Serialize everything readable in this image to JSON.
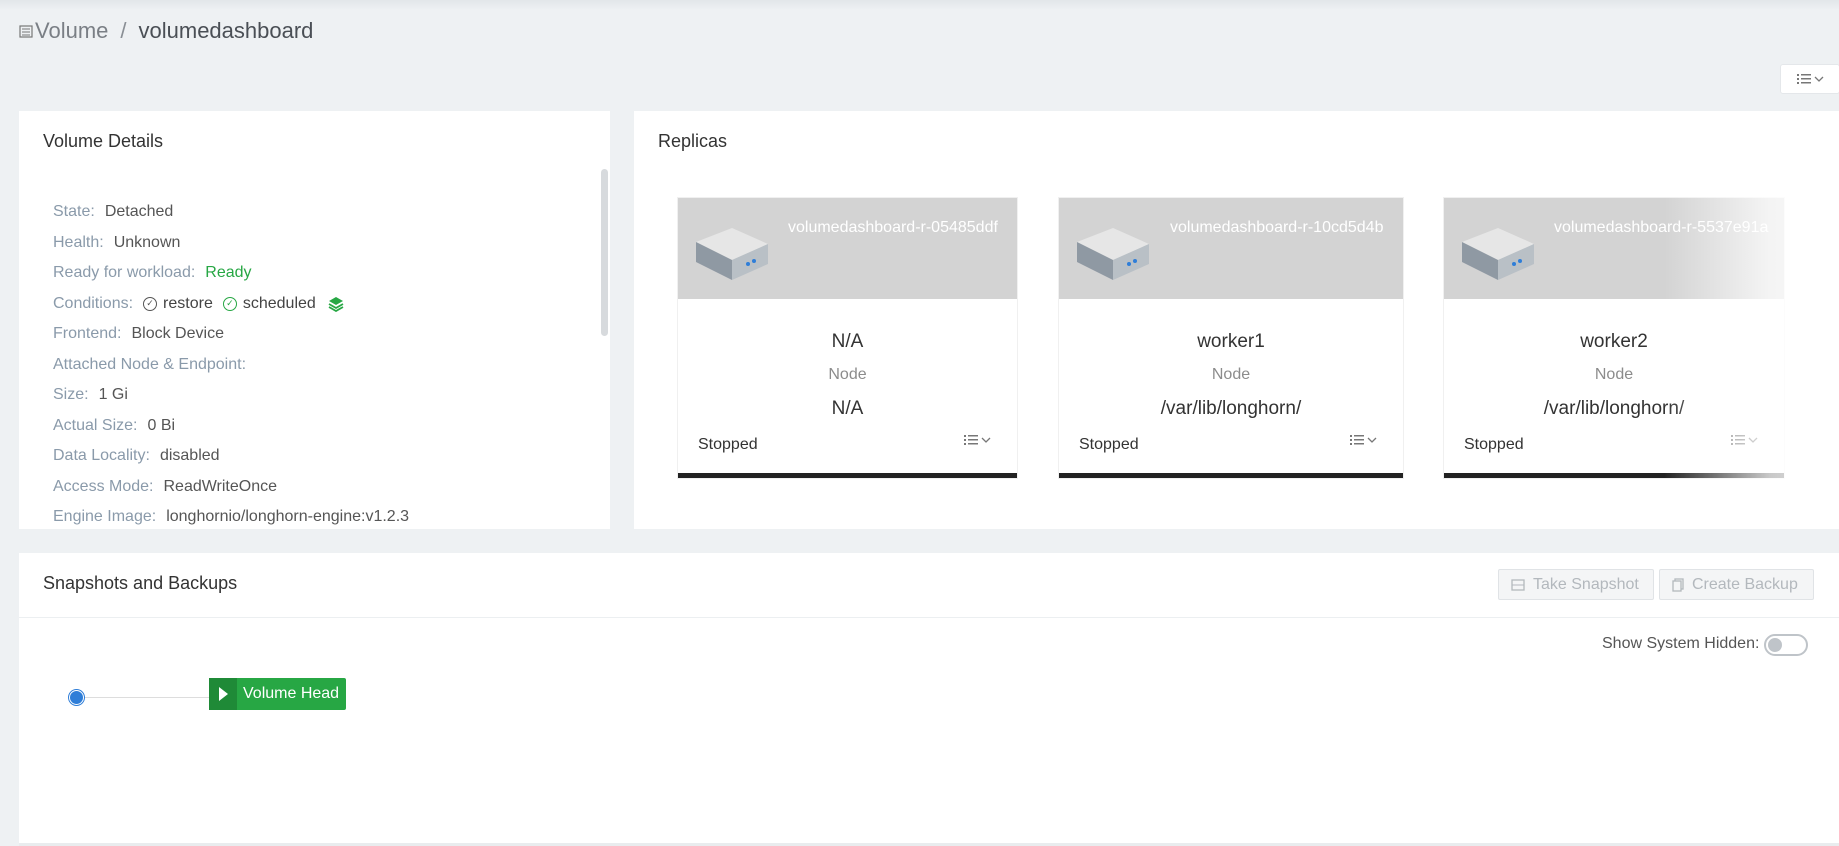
{
  "breadcrumb": {
    "root": "Volume",
    "separator": "/",
    "current": "volumedashboard"
  },
  "details": {
    "title": "Volume Details",
    "state_k": "State:",
    "state_v": "Detached",
    "health_k": "Health:",
    "health_v": "Unknown",
    "ready_k": "Ready for workload:",
    "ready_v": "Ready",
    "conditions_k": "Conditions:",
    "cond1": "restore",
    "cond2": "scheduled",
    "frontend_k": "Frontend:",
    "frontend_v": "Block Device",
    "attached_k": "Attached Node & Endpoint:",
    "size_k": "Size:",
    "size_v": "1 Gi",
    "actual_k": "Actual Size:",
    "actual_v": "0 Bi",
    "locality_k": "Data Locality:",
    "locality_v": "disabled",
    "access_k": "Access Mode:",
    "access_v": "ReadWriteOnce",
    "engine_k": "Engine Image:",
    "engine_v": "longhornio/longhorn-engine:v1.2.3"
  },
  "replicas": {
    "title": "Replicas",
    "node_label": "Node",
    "items": [
      {
        "name": "volumedashboard-r-05485ddf",
        "node": "N/A",
        "path": "N/A",
        "status": "Stopped"
      },
      {
        "name": "volumedashboard-r-10cd5d4b",
        "node": "worker1",
        "path": "/var/lib/longhorn/",
        "status": "Stopped"
      },
      {
        "name": "volumedashboard-r-5537e91a",
        "node": "worker2",
        "path": "/var/lib/longhorn/",
        "status": "Stopped"
      }
    ]
  },
  "snapshots": {
    "title": "Snapshots and Backups",
    "take_snapshot": "Take Snapshot",
    "create_backup": "Create Backup",
    "show_hidden": "Show System Hidden:",
    "volume_head": "Volume Head"
  },
  "colors": {
    "ready": "#27a744",
    "accent_blue": "#2f7ed8",
    "status_bar": "#222222"
  }
}
